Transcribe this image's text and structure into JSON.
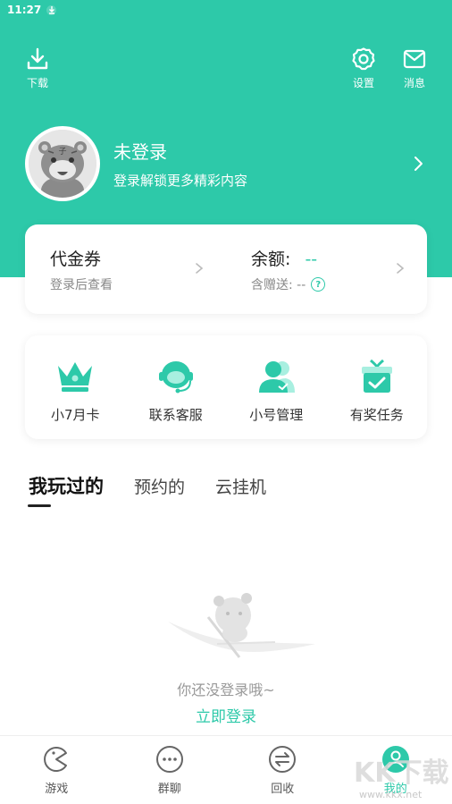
{
  "status_bar": {
    "time": "11:27"
  },
  "header": {
    "download_label": "下载",
    "settings_label": "设置",
    "messages_label": "消息"
  },
  "profile": {
    "name": "未登录",
    "subtitle": "登录解锁更多精彩内容"
  },
  "wallet": {
    "voucher_title": "代金券",
    "voucher_sub": "登录后查看",
    "balance_title": "余额:",
    "balance_value": "--",
    "gift_label": "含赠送: --"
  },
  "services": [
    {
      "label": "小7月卡",
      "icon": "crown-icon"
    },
    {
      "label": "联系客服",
      "icon": "customer-service-icon"
    },
    {
      "label": "小号管理",
      "icon": "account-management-icon"
    },
    {
      "label": "有奖任务",
      "icon": "gift-task-icon"
    }
  ],
  "tabs": [
    {
      "label": "我玩过的",
      "active": true
    },
    {
      "label": "预约的",
      "active": false
    },
    {
      "label": "云挂机",
      "active": false
    }
  ],
  "empty_state": {
    "message": "你还没登录哦~",
    "login_link": "立即登录"
  },
  "bottom_nav": [
    {
      "label": "游戏",
      "icon": "game-icon",
      "active": false
    },
    {
      "label": "群聊",
      "icon": "chat-icon",
      "active": false
    },
    {
      "label": "回收",
      "icon": "recycle-icon",
      "active": false
    },
    {
      "label": "我的",
      "icon": "profile-icon",
      "active": true
    }
  ],
  "watermark": {
    "text": "KK下载",
    "url_text": "www.kkx.net"
  },
  "colors": {
    "accent": "#2dc9a9",
    "text_dark": "#222222",
    "text_muted": "#999999"
  }
}
